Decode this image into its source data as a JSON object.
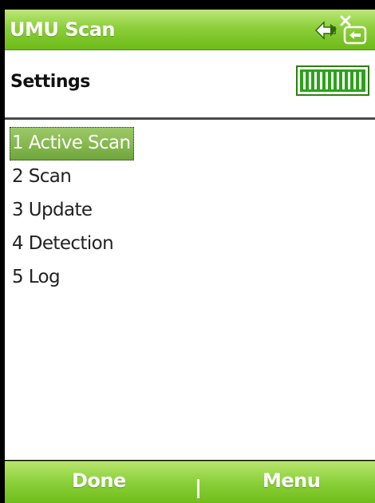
{
  "app": {
    "title": "UMU Scan",
    "connection_icon": "data-connection-icon",
    "accent_color": "#7ac52a"
  },
  "header": {
    "title": "Settings",
    "battery_icon": "battery-full-icon",
    "battery_level": 1.0
  },
  "menu": {
    "items": [
      {
        "label": "1 Active Scan",
        "selected": true
      },
      {
        "label": "2 Scan",
        "selected": false
      },
      {
        "label": "3 Update",
        "selected": false
      },
      {
        "label": "4 Detection",
        "selected": false
      },
      {
        "label": "5 Log",
        "selected": false
      }
    ]
  },
  "softkeys": {
    "left": "Done",
    "right": "Menu"
  }
}
